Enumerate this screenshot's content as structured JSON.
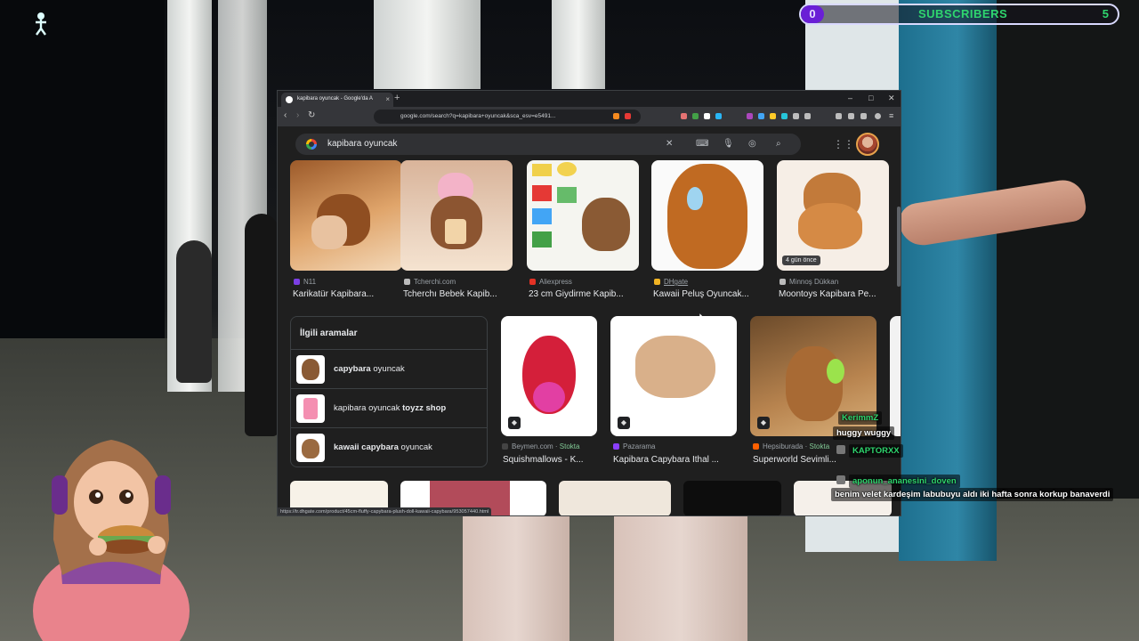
{
  "overlay": {
    "subscribers": {
      "left_value": "0",
      "label": "SUBSCRIBERS",
      "right_value": "5"
    }
  },
  "browser": {
    "tab": {
      "title": "kapibara oyuncak - Google'da A"
    },
    "address": "google.com/search?q=kapibara+oyuncak&sca_esv=e5491...",
    "status_url": "https://tr.dhgate.com/product/45cm-fluffy-capybara-plush-doll-kawaii-capybara/953057440.html"
  },
  "search": {
    "query": "kapibara oyuncak"
  },
  "image_results": [
    {
      "source": "N11",
      "title": "Karikatür Kapibara...",
      "source_color": "#7b3fe4"
    },
    {
      "source": "Tcherchi.com",
      "title": "Tcherchı Bebek Kapib...",
      "source_color": "#bbbbbb"
    },
    {
      "source": "Aliexpress",
      "title": "23 cm Giydirme Kapib...",
      "source_color": "#e43225"
    },
    {
      "source": "DHgate",
      "title": "Kawaii Peluş Oyuncak...",
      "source_color": "#f0b323"
    },
    {
      "source": "Minnoş Dükkan",
      "title": "Moontoys Kapibara Pe...",
      "source_color": "#bbbbbb",
      "badge": "4 gün önce"
    }
  ],
  "related": {
    "heading": "İlgili aramalar",
    "items": [
      {
        "bold": "capybara",
        "rest": " oyuncak"
      },
      {
        "plain": "kapibara oyuncak ",
        "bold_end": "toyzz shop"
      },
      {
        "bold": "kawaii capybara",
        "rest": " oyuncak"
      }
    ]
  },
  "products": [
    {
      "source": "Beymen.com",
      "stock": "Stokta",
      "title": "Squishmallows - K...",
      "source_color": "#444444"
    },
    {
      "source": "Pazarama",
      "stock": "",
      "title": "Kapibara Capybara İthal ...",
      "source_color": "#8a3ffc"
    },
    {
      "source": "Hepsiburada",
      "stock": "Stokta",
      "title": "Superworld Sevimli...",
      "source_color": "#ff6000"
    }
  ],
  "chat": [
    {
      "user": "KerimmZ",
      "message": "huggy wuggy",
      "user_color": "#2fd66e"
    },
    {
      "user": "KAPTORXX",
      "message": "",
      "user_color": "#2fd66e"
    },
    {
      "user": "aponun_ananesini_doven",
      "message": "benim velet kardeşim labubuyu aldı iki hafta sonra korkup banaverdi",
      "user_color": "#2fd66e"
    }
  ],
  "icons": [
    "google-logo",
    "clear-icon",
    "keyboard-icon",
    "mic-icon",
    "lens-icon",
    "search-icon",
    "apps-icon",
    "account-avatar",
    "shopping-tag-icon"
  ]
}
